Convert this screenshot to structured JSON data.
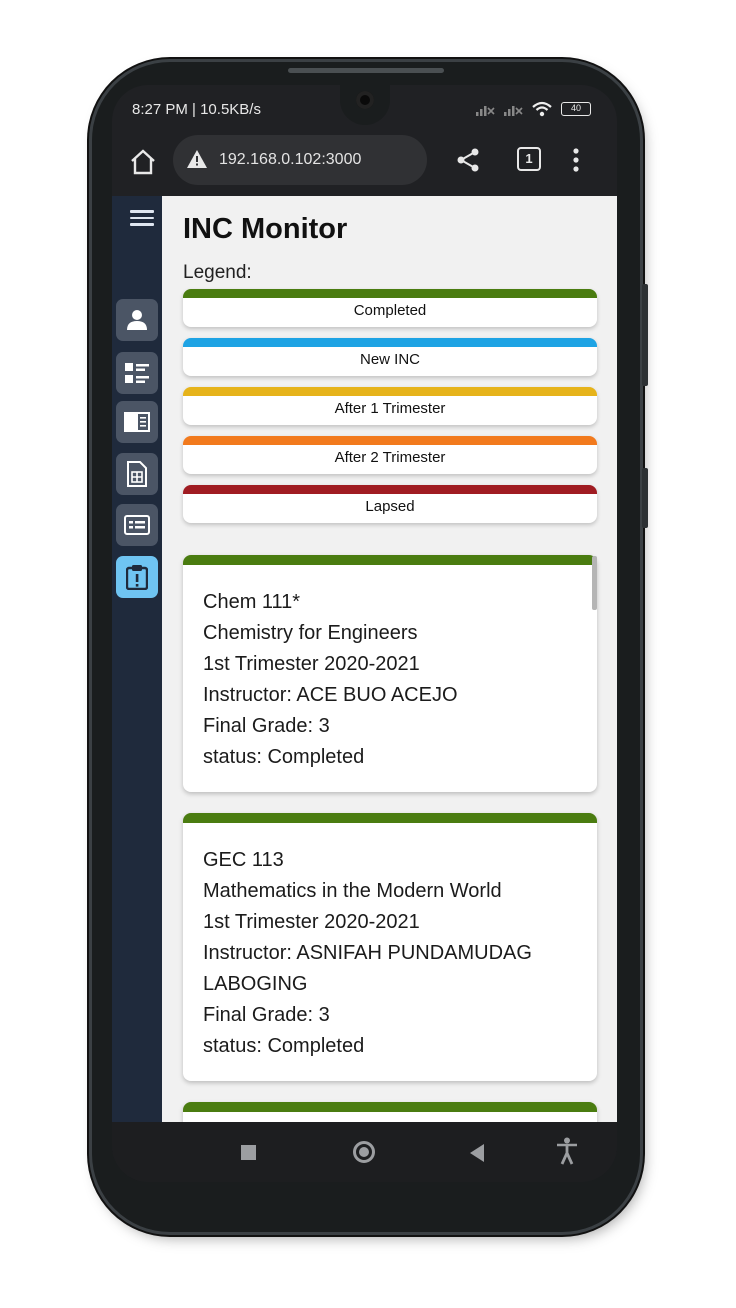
{
  "status_bar": {
    "time_speed": "8:27 PM | 10.5KB/s",
    "battery": "40"
  },
  "browser": {
    "url": "192.168.0.102:3000",
    "tab_count": "1"
  },
  "page": {
    "title": "INC Monitor",
    "legend_label": "Legend:",
    "legend": [
      {
        "label": "Completed",
        "color": "#4a7c10"
      },
      {
        "label": "New INC",
        "color": "#1ea3e4"
      },
      {
        "label": "After 1 Trimester",
        "color": "#e6b31a"
      },
      {
        "label": "After 2 Trimester",
        "color": "#f27a1d"
      },
      {
        "label": "Lapsed",
        "color": "#a01c22"
      }
    ],
    "cards": [
      {
        "code": "Chem 111*",
        "name": "Chemistry for Engineers",
        "term": "1st Trimester 2020-2021",
        "instructor": "Instructor: ACE BUO ACEJO",
        "grade": "Final Grade: 3",
        "status": "status: Completed"
      },
      {
        "code": "GEC 113",
        "name": "Mathematics in the Modern World",
        "term": "1st Trimester 2020-2021",
        "instructor": "Instructor: ASNIFAH PUNDAMUDAG LABOGING",
        "grade": "Final Grade: 3",
        "status": "status: Completed"
      }
    ]
  },
  "sidebar_icons": [
    "menu-icon",
    "user-icon",
    "list-icon",
    "book-icon",
    "document-icon",
    "id-card-icon",
    "clipboard-alert-icon"
  ]
}
